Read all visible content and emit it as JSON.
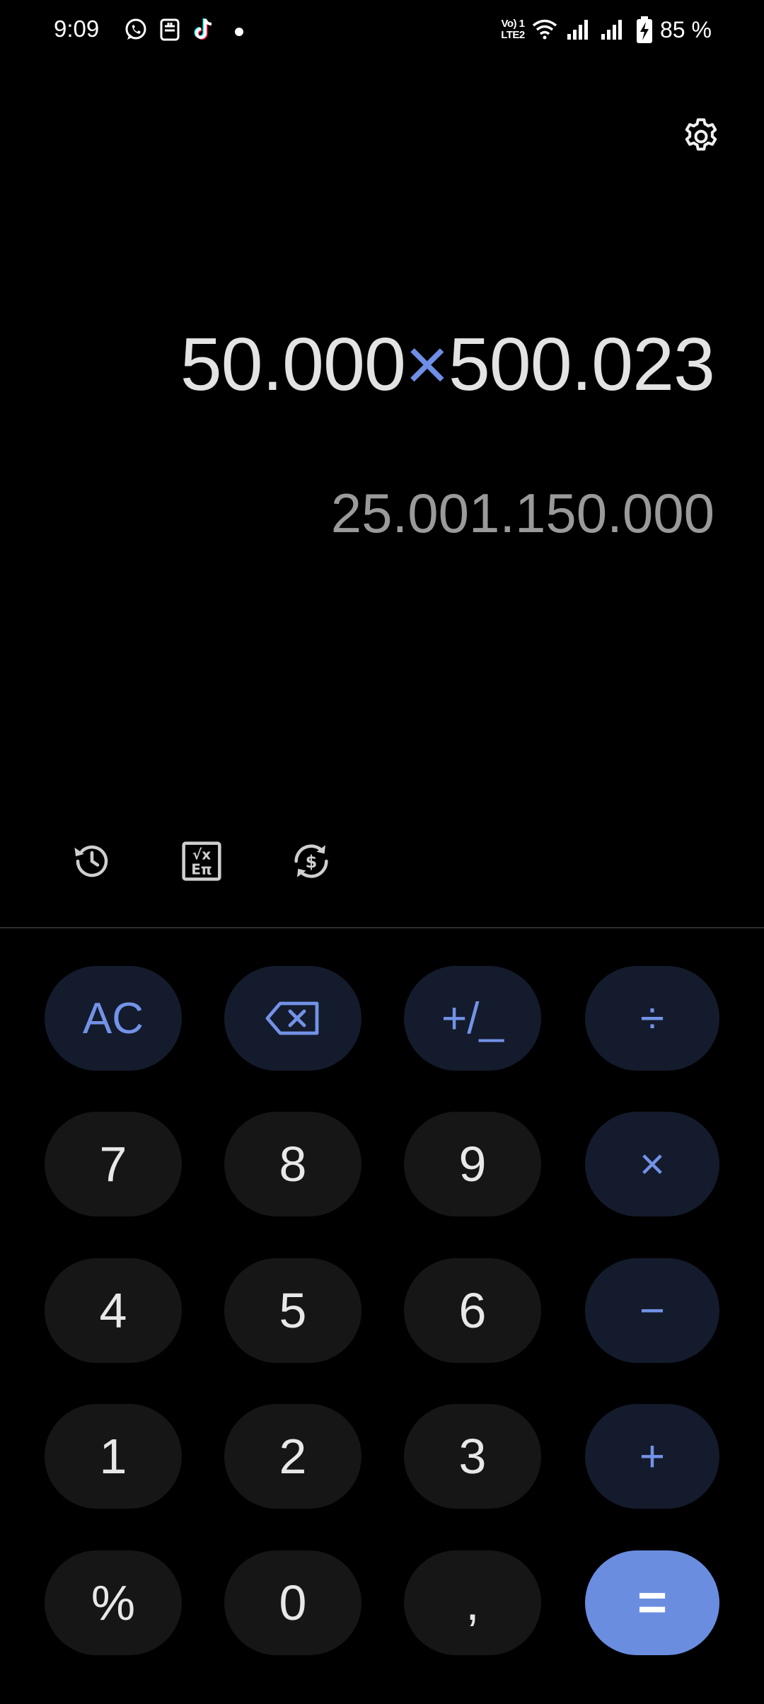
{
  "status_bar": {
    "time": "9:09",
    "network_label": "Vo) 1 LTE2",
    "battery": "85 %",
    "icons": [
      "whatsapp-icon",
      "notification-app-icon",
      "tiktok-icon",
      "more-notifications-dot",
      "wifi-icon",
      "signal-1-icon",
      "signal-2-icon",
      "battery-charging-icon"
    ]
  },
  "display": {
    "expression_left": "50.000",
    "expression_operator": "×",
    "expression_right": "500.023",
    "result": "25.001.150.000"
  },
  "tools": [
    "history-icon",
    "scientific-mode-icon",
    "unit-converter-icon"
  ],
  "keys": {
    "ac": "AC",
    "plus_minus": "+/_",
    "divide": "÷",
    "seven": "7",
    "eight": "8",
    "nine": "9",
    "multiply": "×",
    "four": "4",
    "five": "5",
    "six": "6",
    "minus": "−",
    "one": "1",
    "two": "2",
    "three": "3",
    "plus": "+",
    "percent": "%",
    "zero": "0",
    "decimal": ",",
    "equals": "="
  },
  "colors": {
    "background": "#000000",
    "accent": "#6f8ee6",
    "equals_bg": "#6a8de0",
    "operator_key_bg": "#141b2c",
    "number_key_bg": "#161616"
  }
}
